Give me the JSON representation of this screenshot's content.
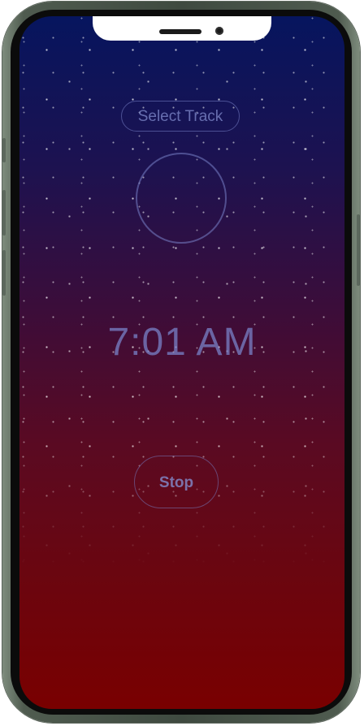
{
  "alarm": {
    "select_track_label": "Select Track",
    "time": "7:01 AM",
    "stop_label": "Stop"
  },
  "colors": {
    "gradient_top": "#06155e",
    "gradient_middle": "#3b0d3a",
    "gradient_bottom": "#790000",
    "accent": "#7882c8",
    "device_frame": "#4f5b4f"
  }
}
